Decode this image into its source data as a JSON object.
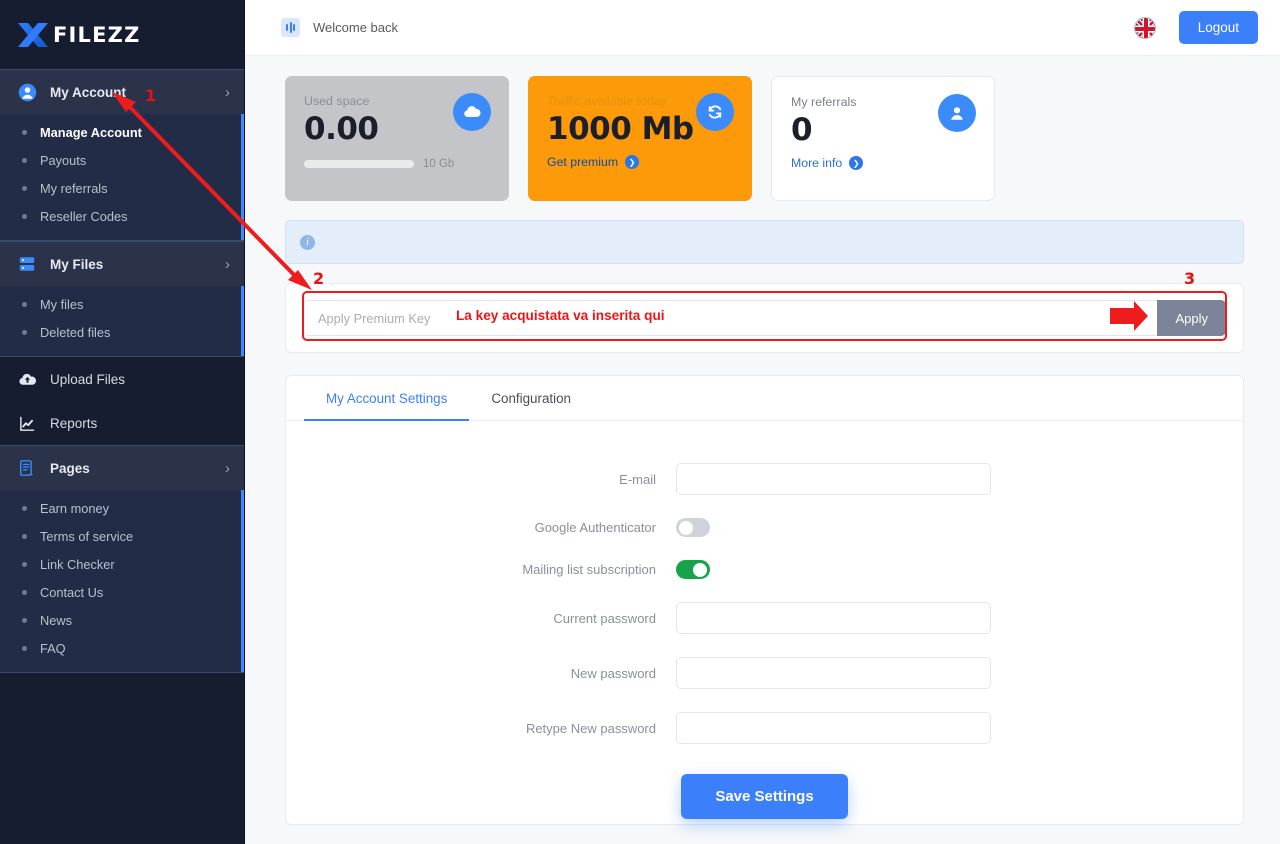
{
  "brand": {
    "mark": "X",
    "name": "FILEZZ"
  },
  "sidebar": {
    "groups": [
      {
        "label": "My Account",
        "icon": "user-circle-icon",
        "expanded": true,
        "chevron": "›",
        "items": [
          {
            "label": "Manage Account",
            "active": true
          },
          {
            "label": "Payouts",
            "active": false
          },
          {
            "label": "My referrals",
            "active": false
          },
          {
            "label": "Reseller Codes",
            "active": false
          }
        ]
      },
      {
        "label": "My Files",
        "icon": "files-icon",
        "expanded": true,
        "chevron": "›",
        "items": [
          {
            "label": "My files",
            "active": false
          },
          {
            "label": "Deleted files",
            "active": false
          }
        ]
      }
    ],
    "singles": [
      {
        "label": "Upload Files",
        "icon": "cloud-upload-icon"
      },
      {
        "label": "Reports",
        "icon": "chart-line-icon"
      }
    ],
    "pages_group": {
      "label": "Pages",
      "icon": "document-icon",
      "chevron": "›",
      "items": [
        {
          "label": "Earn money"
        },
        {
          "label": "Terms of service"
        },
        {
          "label": "Link Checker"
        },
        {
          "label": "Contact Us"
        },
        {
          "label": "News"
        },
        {
          "label": "FAQ"
        }
      ]
    }
  },
  "topbar": {
    "welcome": "Welcome back",
    "welcome_icon": "equalizer-icon",
    "flag_icon": "uk-flag-icon",
    "logout_label": "Logout"
  },
  "stats": [
    {
      "label": "Used space",
      "value": "0.00",
      "icon": "cloud-icon",
      "capacity": "10 Gb",
      "progress_pct": 0,
      "style": "grey"
    },
    {
      "label": "Traffic available today",
      "value": "1000 Mb",
      "icon": "refresh-icon",
      "link": "Get premium",
      "style": "orange"
    },
    {
      "label": "My referrals",
      "value": "0",
      "icon": "user-icon",
      "link": "More info",
      "style": "white"
    }
  ],
  "info_bar": {
    "icon": "info-icon",
    "text": ""
  },
  "premium_key": {
    "placeholder": "Apply Premium Key",
    "value": "",
    "apply_label": "Apply",
    "annotation_text": "La key acquistata va inserita qui"
  },
  "tabs": [
    {
      "label": "My Account Settings",
      "active": true
    },
    {
      "label": "Configuration",
      "active": false
    }
  ],
  "form": {
    "fields": [
      {
        "label": "E-mail",
        "type": "text",
        "value": ""
      },
      {
        "label": "Google Authenticator",
        "type": "toggle",
        "on": false
      },
      {
        "label": "Mailing list subscription",
        "type": "toggle",
        "on": true
      },
      {
        "label": "Current password",
        "type": "password",
        "value": ""
      },
      {
        "label": "New password",
        "type": "password",
        "value": ""
      },
      {
        "label": "Retype New password",
        "type": "password",
        "value": ""
      }
    ],
    "save_label": "Save Settings"
  },
  "annotations": {
    "color": "#ee1c1c",
    "markers": [
      {
        "id": "1",
        "label": "1"
      },
      {
        "id": "2",
        "label": "2"
      },
      {
        "id": "3",
        "label": "3"
      }
    ]
  },
  "colors": {
    "accent": "#3b7ffb",
    "sidebar_bg": "#161d31",
    "sidebar_active": "#222c47",
    "orange": "#fd9a09",
    "green": "#16a34a",
    "annotation_red": "#ee1c1c",
    "apply_btn": "#7c8499"
  }
}
